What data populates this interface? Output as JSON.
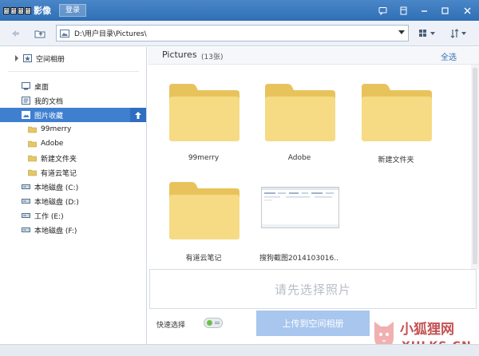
{
  "app": {
    "logo_letters": [
      "图",
      "图",
      "图",
      "图"
    ],
    "title": "影像",
    "login_label": "登录",
    "title_icons": [
      "chat-icon",
      "skin-icon",
      "minimize-icon",
      "maximize-icon",
      "close-icon"
    ]
  },
  "address": {
    "path": "D:\\用户目录\\Pictures\\"
  },
  "sidebar": {
    "items": [
      {
        "label": "空间相册",
        "icon": "album-icon",
        "indent": 0
      },
      {
        "label": "桌面",
        "icon": "desktop-icon",
        "indent": 0
      },
      {
        "label": "我的文档",
        "icon": "documents-icon",
        "indent": 0
      },
      {
        "label": "图片收藏",
        "icon": "pictures-icon",
        "indent": 0,
        "selected": true
      },
      {
        "label": "99merry",
        "icon": "folder-icon",
        "indent": 1
      },
      {
        "label": "Adobe",
        "icon": "folder-icon",
        "indent": 1
      },
      {
        "label": "新建文件夹",
        "icon": "folder-icon",
        "indent": 1
      },
      {
        "label": "有道云笔记",
        "icon": "folder-icon",
        "indent": 1
      },
      {
        "label": "本地磁盘 (C:)",
        "icon": "drive-icon",
        "indent": 0
      },
      {
        "label": "本地磁盘 (D:)",
        "icon": "drive-icon",
        "indent": 0
      },
      {
        "label": "工作 (E:)",
        "icon": "drive-icon",
        "indent": 0
      },
      {
        "label": "本地磁盘 (F:)",
        "icon": "drive-icon",
        "indent": 0
      }
    ]
  },
  "main": {
    "title": "Pictures",
    "count": "(13张)",
    "select_all": "全选",
    "items": [
      {
        "label": "99merry",
        "kind": "folder"
      },
      {
        "label": "Adobe",
        "kind": "folder"
      },
      {
        "label": "新建文件夹",
        "kind": "folder"
      },
      {
        "label": "有道云笔记",
        "kind": "folder"
      },
      {
        "label": "搜狗截图2014103016...",
        "kind": "image"
      }
    ],
    "drop_hint": "请先选择照片",
    "quick_select_label": "快速选择",
    "upload_label": "上传到空间相册"
  },
  "watermark": {
    "title": "小狐狸网",
    "url": "XHLKS.CN"
  },
  "colors": {
    "titlebar": "#3a78bf",
    "selected": "#3f7fd0",
    "folder": "#f5d677",
    "upload": "#a8c6ee"
  }
}
